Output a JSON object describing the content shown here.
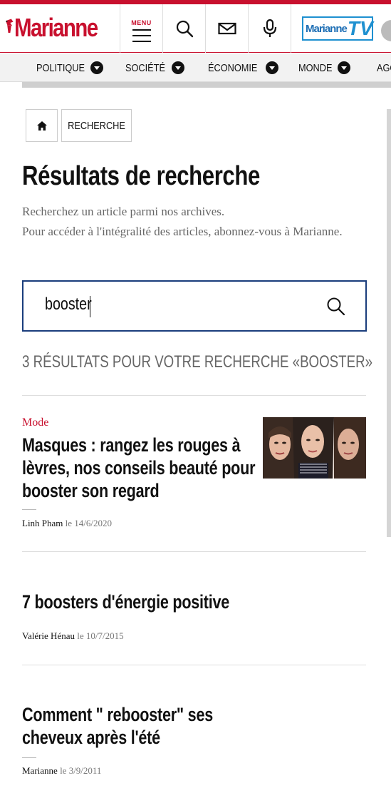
{
  "brand": {
    "name": "Marianne",
    "accent": "#c8102e",
    "tv_name": "Marianne",
    "tv_suffix": "TV"
  },
  "header": {
    "menu_label": "MENU",
    "icons": [
      "search-icon",
      "mail-icon",
      "microphone-icon",
      "user-avatar"
    ]
  },
  "nav": {
    "items": [
      {
        "label": "POLITIQUE"
      },
      {
        "label": "SOCIÉTÉ"
      },
      {
        "label": "ÉCONOMIE"
      },
      {
        "label": "MONDE"
      },
      {
        "label": "AGO"
      }
    ]
  },
  "breadcrumb": {
    "home_icon": "home-icon",
    "current": "RECHERCHE"
  },
  "page": {
    "title": "Résultats de recherche",
    "intro_line1": "Recherchez un article parmi nos archives.",
    "intro_line2": "Pour accéder à l'intégralité des articles, abonnez-vous à Marianne."
  },
  "search": {
    "value": "booster",
    "button_icon": "search-icon"
  },
  "results": {
    "count_text": "3 RÉSULTATS POUR VOTRE RECHERCHE «BOOSTER»",
    "items": [
      {
        "category": "Mode",
        "title": "Masques : rangez les rouges à lèvres, nos conseils beauté pour booster son regard",
        "author": "Linh Pham",
        "date": "le 14/6/2020"
      },
      {
        "category": "",
        "title": "7 boosters d'énergie positive",
        "author": "Valérie Hénau",
        "date": "le 10/7/2015"
      },
      {
        "category": "",
        "title": "Comment \" rebooster\" ses cheveux après l'été",
        "author": "Marianne",
        "date": "le 3/9/2011"
      }
    ]
  }
}
